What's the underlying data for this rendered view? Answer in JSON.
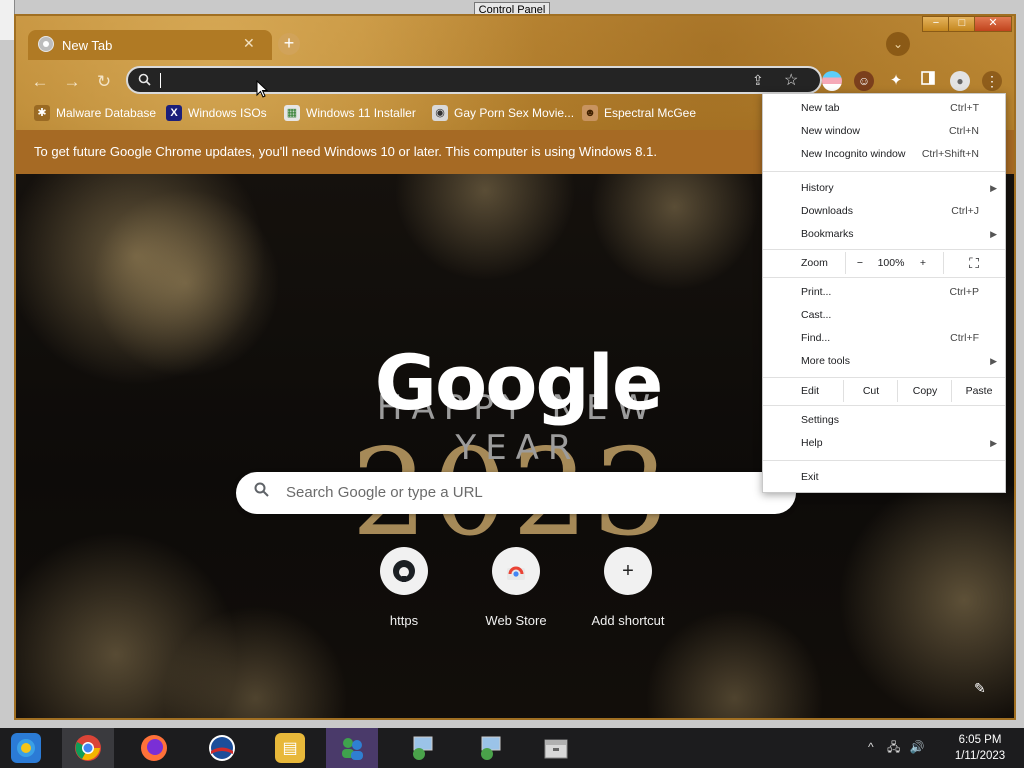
{
  "background_window": {
    "title": "Control Panel"
  },
  "window_controls": {
    "minimize": "−",
    "maximize": "□",
    "close": "✕"
  },
  "tab": {
    "title": "New Tab",
    "close": "✕"
  },
  "toolbar": {
    "back": "←",
    "forward": "→",
    "reload": "↻",
    "new_tab": "+",
    "tab_search": "⌄",
    "search_icon": "🔍",
    "share_icon": "⇪",
    "star_icon": "☆",
    "extensions": [
      "flag",
      "avatar",
      "puzzle-extension",
      "sidebar",
      "profile",
      "menu"
    ],
    "menu": "⋮"
  },
  "bookmarks": [
    {
      "label": "Malware Database"
    },
    {
      "label": "Windows ISOs"
    },
    {
      "label": "Windows 11 Installer"
    },
    {
      "label": "Gay Porn Sex Movie..."
    },
    {
      "label": "Espectral McGee"
    }
  ],
  "infobar": {
    "text": "To get future Google Chrome updates, you'll need Windows 10 or later. This computer is using Windows 8.1."
  },
  "ntp": {
    "doodle": {
      "logo": "Google",
      "tagline": "HAPPY NEW YEAR",
      "year": "2023"
    },
    "search_placeholder": "Search Google or type a URL",
    "shortcuts": [
      {
        "label": "https",
        "icon": "github-icon"
      },
      {
        "label": "Web Store",
        "icon": "chrome-webstore-icon"
      },
      {
        "label": "Add shortcut",
        "icon": "plus-icon",
        "glyph": "+"
      }
    ],
    "customize_icon": "✎"
  },
  "menu": {
    "items": [
      {
        "label": "New tab",
        "shortcut": "Ctrl+T"
      },
      {
        "label": "New window",
        "shortcut": "Ctrl+N"
      },
      {
        "label": "New Incognito window",
        "shortcut": "Ctrl+Shift+N"
      },
      {
        "label": "History",
        "submenu": true
      },
      {
        "label": "Downloads",
        "shortcut": "Ctrl+J"
      },
      {
        "label": "Bookmarks",
        "submenu": true
      },
      {
        "label": "Print...",
        "shortcut": "Ctrl+P"
      },
      {
        "label": "Cast..."
      },
      {
        "label": "Find...",
        "shortcut": "Ctrl+F"
      },
      {
        "label": "More tools",
        "submenu": true
      },
      {
        "label": "Settings"
      },
      {
        "label": "Help",
        "submenu": true
      },
      {
        "label": "Exit"
      }
    ],
    "zoom": {
      "label": "Zoom",
      "minus": "−",
      "value": "100%",
      "plus": "+",
      "fullscreen": "⛶"
    },
    "edit": {
      "label": "Edit",
      "cut": "Cut",
      "copy": "Copy",
      "paste": "Paste"
    }
  },
  "taskbar": {
    "apps": [
      {
        "name": "windows-start"
      },
      {
        "name": "chrome"
      },
      {
        "name": "firefox"
      },
      {
        "name": "obama-logo"
      },
      {
        "name": "file-explorer"
      },
      {
        "name": "messenger"
      },
      {
        "name": "network-setup-1"
      },
      {
        "name": "network-setup-2"
      },
      {
        "name": "archive"
      }
    ],
    "tray": {
      "chevron": "^",
      "network": "🖧",
      "volume": "🔊"
    },
    "clock": {
      "time": "6:05 PM",
      "date": "1/11/2023"
    }
  }
}
